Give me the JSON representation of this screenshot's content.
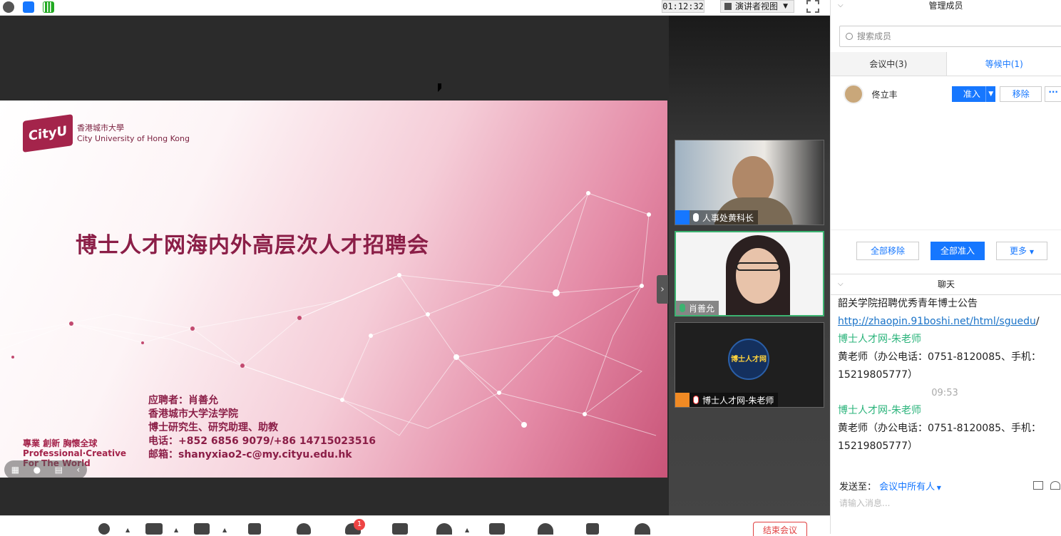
{
  "topbar": {
    "timer": "01:12:32",
    "view_mode": "演讲者视图"
  },
  "slide": {
    "logo_mark": "CityU",
    "logo_cn": "香港城市大學",
    "logo_en": "City University of Hong Kong",
    "headline": "博士人才网海内外高层次人才招聘会",
    "applicant": [
      "应聘者：肖善允",
      "香港城市大学法学院",
      "博士研究生、研究助理、助教",
      "电话：+852 6856 9079/+86 14715023516",
      "邮箱：shanyxiao2-c@my.cityu.edu.hk"
    ],
    "motto": [
      "專業 創新 胸懷全球",
      "Professional·Creative",
      "For The World"
    ]
  },
  "thumbnails": [
    {
      "name": "人事处黄科长"
    },
    {
      "name": "肖善允"
    },
    {
      "name": "博士人才网-朱老师",
      "logo_text": "博士人才网"
    }
  ],
  "members": {
    "title": "管理成员",
    "search_placeholder": "搜索成员",
    "tab_in": "会议中(3)",
    "tab_wait": "等候中(1)",
    "waiting": [
      {
        "name": "佟立丰"
      }
    ],
    "admit": "准入",
    "remove": "移除",
    "remove_all": "全部移除",
    "admit_all": "全部准入",
    "more": "更多"
  },
  "chat": {
    "title": "聊天",
    "messages": [
      {
        "kind": "text",
        "text": "韶关学院招聘优秀青年博士公告"
      },
      {
        "kind": "link",
        "text": "http://zhaopin.91boshi.net/html/sguedu",
        "suffix": "/"
      },
      {
        "kind": "sender",
        "text": "博士人才网-朱老师"
      },
      {
        "kind": "text",
        "text": "黄老师（办公电话：0751-8120085、手机：15219805777）"
      },
      {
        "kind": "time",
        "text": "09:53"
      },
      {
        "kind": "sender",
        "text": "博士人才网-朱老师"
      },
      {
        "kind": "text",
        "text": "黄老师（办公电话：0751-8120085、手机：15219805777）"
      }
    ],
    "send_to_label": "发送至：",
    "send_to_value": "会议中所有人",
    "input_placeholder": "请输入消息..."
  },
  "toolbar": {
    "participant_badge": "1",
    "end_meeting": "结束会议"
  },
  "colors": {
    "accent": "#1677ff",
    "speaking": "#3cb371",
    "slide_text": "#8b1e47",
    "sender": "#29b37a"
  }
}
